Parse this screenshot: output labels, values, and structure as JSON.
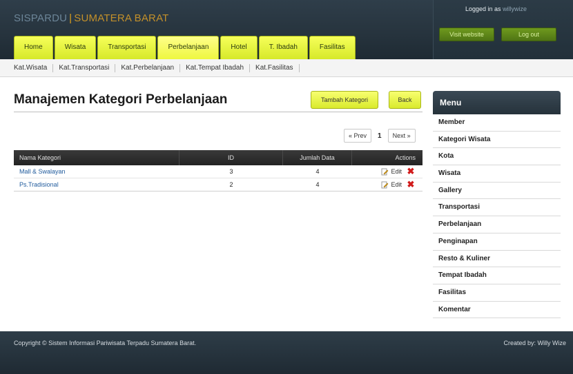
{
  "header": {
    "brand_part1": "SISPARDU",
    "brand_separator": "|",
    "brand_part2": "SUMATERA BARAT",
    "logged_in_label": "Logged in as",
    "username": "willywize",
    "visit_website": "Visit website",
    "log_out": "Log out",
    "tabs": [
      {
        "label": "Home"
      },
      {
        "label": "Wisata"
      },
      {
        "label": "Transportasi"
      },
      {
        "label": "Perbelanjaan"
      },
      {
        "label": "Hotel"
      },
      {
        "label": "T. Ibadah"
      },
      {
        "label": "Fasilitas"
      }
    ],
    "active_tab": "Perbelanjaan"
  },
  "subnav": [
    "Kat.Wisata",
    "Kat.Transportasi",
    "Kat.Perbelanjaan",
    "Kat.Tempat Ibadah",
    "Kat.Fasilitas"
  ],
  "main": {
    "title": "Manajemen Kategori Perbelanjaan",
    "add_button": "Tambah Kategori",
    "back_button": "Back",
    "pager": {
      "prev": "« Prev",
      "current": "1",
      "next": "Next »"
    },
    "table": {
      "columns": [
        "Nama Kategori",
        "ID",
        "Jumlah Data",
        "Actions"
      ],
      "edit_label": "Edit",
      "rows": [
        {
          "name": "Mall & Swalayan",
          "id": "3",
          "count": "4"
        },
        {
          "name": "Ps.Tradisional",
          "id": "2",
          "count": "4"
        }
      ]
    }
  },
  "sidebar": {
    "title": "Menu",
    "items": [
      "Member",
      "Kategori Wisata",
      "Kota",
      "Wisata",
      "Gallery",
      "Transportasi",
      "Perbelanjaan",
      "Penginapan",
      "Resto & Kuliner",
      "Tempat Ibadah",
      "Fasilitas",
      "Komentar"
    ]
  },
  "footer": {
    "copyright": "Copyright © Sistem Informasi Pariwisata Terpadu Sumatera Barat.",
    "credit": "Created by: Willy Wize"
  },
  "colors": {
    "accent_tab": "#e6f23a",
    "header_bg": "#26333d",
    "delete": "#d11b1b",
    "link": "#1f5a9c"
  }
}
